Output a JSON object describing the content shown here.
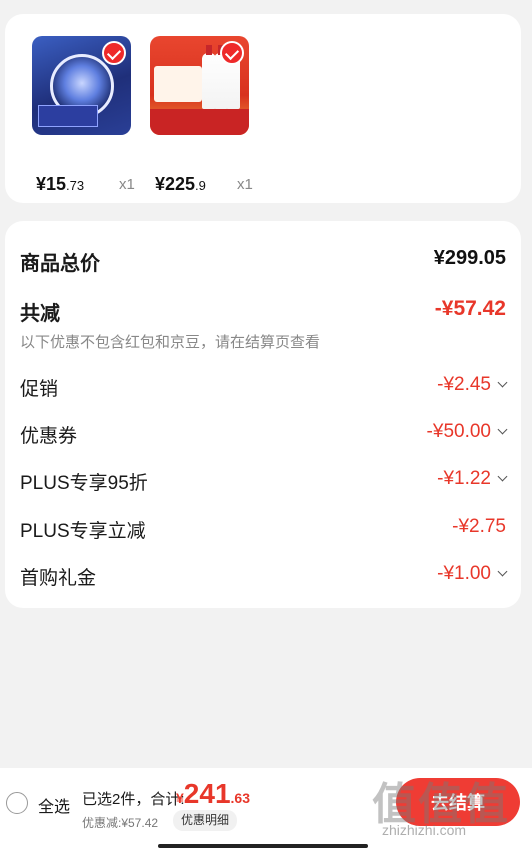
{
  "products": [
    {
      "price_int": "¥15",
      "price_dec": ".73",
      "qty": "x1"
    },
    {
      "price_int": "¥225",
      "price_dec": ".9",
      "qty": "x1"
    }
  ],
  "summary": {
    "total_label": "商品总价",
    "total_value": "¥299.05",
    "reduce_label": "共减",
    "reduce_value": "-¥57.42",
    "note": "以下优惠不包含红包和京豆，请在结算页查看",
    "items": [
      {
        "label": "促销",
        "value": "-¥2.45"
      },
      {
        "label": "优惠券",
        "value": "-¥50.00"
      },
      {
        "label": "PLUS专享95折",
        "value": "-¥1.22"
      },
      {
        "label": "PLUS专享立减",
        "value": "-¥2.75"
      },
      {
        "label": "首购礼金",
        "value": "-¥1.00"
      }
    ]
  },
  "bottom": {
    "select_all": "全选",
    "selected_text": "已选2件，合计:",
    "total_cur": "¥",
    "total_int": "241",
    "total_dec": ".63",
    "discount_text": "优惠减:¥57.42",
    "detail_button": "优惠明细",
    "checkout": "去结算"
  },
  "watermark": {
    "logo": "值值值",
    "url": "zhizhizhi.com"
  },
  "colors": {
    "accent": "#e8372a",
    "background": "#f2f2f2"
  }
}
